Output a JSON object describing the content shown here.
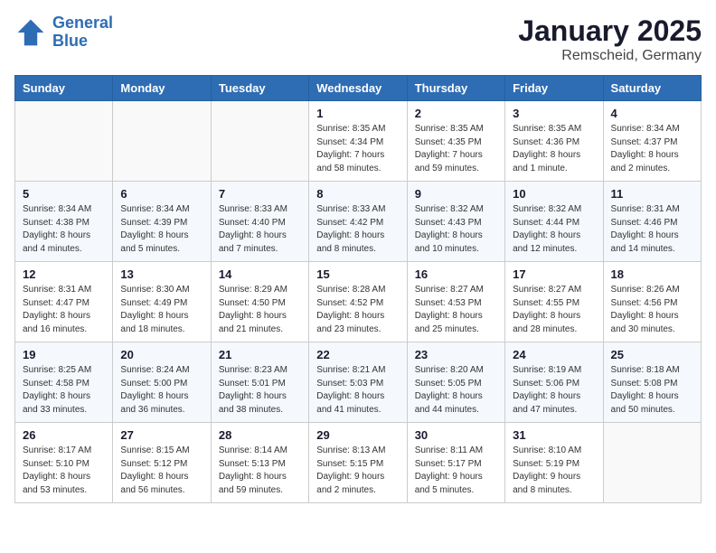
{
  "app": {
    "name_line1": "General",
    "name_line2": "Blue"
  },
  "title": "January 2025",
  "subtitle": "Remscheid, Germany",
  "days_of_week": [
    "Sunday",
    "Monday",
    "Tuesday",
    "Wednesday",
    "Thursday",
    "Friday",
    "Saturday"
  ],
  "weeks": [
    [
      {
        "day": "",
        "info": ""
      },
      {
        "day": "",
        "info": ""
      },
      {
        "day": "",
        "info": ""
      },
      {
        "day": "1",
        "info": "Sunrise: 8:35 AM\nSunset: 4:34 PM\nDaylight: 7 hours\nand 58 minutes."
      },
      {
        "day": "2",
        "info": "Sunrise: 8:35 AM\nSunset: 4:35 PM\nDaylight: 7 hours\nand 59 minutes."
      },
      {
        "day": "3",
        "info": "Sunrise: 8:35 AM\nSunset: 4:36 PM\nDaylight: 8 hours\nand 1 minute."
      },
      {
        "day": "4",
        "info": "Sunrise: 8:34 AM\nSunset: 4:37 PM\nDaylight: 8 hours\nand 2 minutes."
      }
    ],
    [
      {
        "day": "5",
        "info": "Sunrise: 8:34 AM\nSunset: 4:38 PM\nDaylight: 8 hours\nand 4 minutes."
      },
      {
        "day": "6",
        "info": "Sunrise: 8:34 AM\nSunset: 4:39 PM\nDaylight: 8 hours\nand 5 minutes."
      },
      {
        "day": "7",
        "info": "Sunrise: 8:33 AM\nSunset: 4:40 PM\nDaylight: 8 hours\nand 7 minutes."
      },
      {
        "day": "8",
        "info": "Sunrise: 8:33 AM\nSunset: 4:42 PM\nDaylight: 8 hours\nand 8 minutes."
      },
      {
        "day": "9",
        "info": "Sunrise: 8:32 AM\nSunset: 4:43 PM\nDaylight: 8 hours\nand 10 minutes."
      },
      {
        "day": "10",
        "info": "Sunrise: 8:32 AM\nSunset: 4:44 PM\nDaylight: 8 hours\nand 12 minutes."
      },
      {
        "day": "11",
        "info": "Sunrise: 8:31 AM\nSunset: 4:46 PM\nDaylight: 8 hours\nand 14 minutes."
      }
    ],
    [
      {
        "day": "12",
        "info": "Sunrise: 8:31 AM\nSunset: 4:47 PM\nDaylight: 8 hours\nand 16 minutes."
      },
      {
        "day": "13",
        "info": "Sunrise: 8:30 AM\nSunset: 4:49 PM\nDaylight: 8 hours\nand 18 minutes."
      },
      {
        "day": "14",
        "info": "Sunrise: 8:29 AM\nSunset: 4:50 PM\nDaylight: 8 hours\nand 21 minutes."
      },
      {
        "day": "15",
        "info": "Sunrise: 8:28 AM\nSunset: 4:52 PM\nDaylight: 8 hours\nand 23 minutes."
      },
      {
        "day": "16",
        "info": "Sunrise: 8:27 AM\nSunset: 4:53 PM\nDaylight: 8 hours\nand 25 minutes."
      },
      {
        "day": "17",
        "info": "Sunrise: 8:27 AM\nSunset: 4:55 PM\nDaylight: 8 hours\nand 28 minutes."
      },
      {
        "day": "18",
        "info": "Sunrise: 8:26 AM\nSunset: 4:56 PM\nDaylight: 8 hours\nand 30 minutes."
      }
    ],
    [
      {
        "day": "19",
        "info": "Sunrise: 8:25 AM\nSunset: 4:58 PM\nDaylight: 8 hours\nand 33 minutes."
      },
      {
        "day": "20",
        "info": "Sunrise: 8:24 AM\nSunset: 5:00 PM\nDaylight: 8 hours\nand 36 minutes."
      },
      {
        "day": "21",
        "info": "Sunrise: 8:23 AM\nSunset: 5:01 PM\nDaylight: 8 hours\nand 38 minutes."
      },
      {
        "day": "22",
        "info": "Sunrise: 8:21 AM\nSunset: 5:03 PM\nDaylight: 8 hours\nand 41 minutes."
      },
      {
        "day": "23",
        "info": "Sunrise: 8:20 AM\nSunset: 5:05 PM\nDaylight: 8 hours\nand 44 minutes."
      },
      {
        "day": "24",
        "info": "Sunrise: 8:19 AM\nSunset: 5:06 PM\nDaylight: 8 hours\nand 47 minutes."
      },
      {
        "day": "25",
        "info": "Sunrise: 8:18 AM\nSunset: 5:08 PM\nDaylight: 8 hours\nand 50 minutes."
      }
    ],
    [
      {
        "day": "26",
        "info": "Sunrise: 8:17 AM\nSunset: 5:10 PM\nDaylight: 8 hours\nand 53 minutes."
      },
      {
        "day": "27",
        "info": "Sunrise: 8:15 AM\nSunset: 5:12 PM\nDaylight: 8 hours\nand 56 minutes."
      },
      {
        "day": "28",
        "info": "Sunrise: 8:14 AM\nSunset: 5:13 PM\nDaylight: 8 hours\nand 59 minutes."
      },
      {
        "day": "29",
        "info": "Sunrise: 8:13 AM\nSunset: 5:15 PM\nDaylight: 9 hours\nand 2 minutes."
      },
      {
        "day": "30",
        "info": "Sunrise: 8:11 AM\nSunset: 5:17 PM\nDaylight: 9 hours\nand 5 minutes."
      },
      {
        "day": "31",
        "info": "Sunrise: 8:10 AM\nSunset: 5:19 PM\nDaylight: 9 hours\nand 8 minutes."
      },
      {
        "day": "",
        "info": ""
      }
    ]
  ]
}
